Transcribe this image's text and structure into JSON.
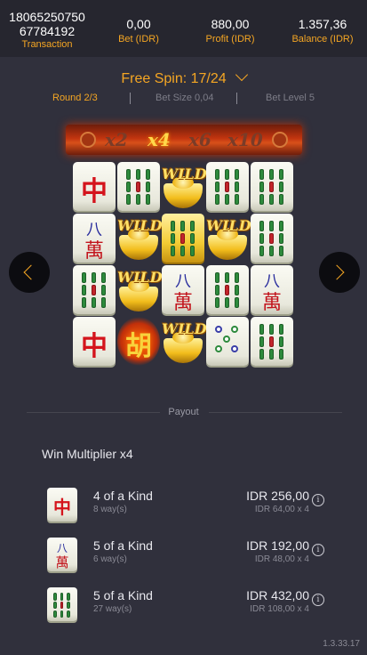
{
  "header": {
    "transaction_id_line1": "18065250750",
    "transaction_id_line2": "67784192",
    "transaction_label": "Transaction",
    "bet_value": "0,00",
    "bet_label": "Bet (IDR)",
    "profit_value": "880,00",
    "profit_label": "Profit (IDR)",
    "balance_value": "1.357,36",
    "balance_label": "Balance (IDR)"
  },
  "spin": {
    "title": "Free Spin: 17/24",
    "round": "Round 2/3",
    "bet_size": "Bet Size 0,04",
    "bet_level": "Bet Level 5"
  },
  "multipliers": {
    "items": [
      "x2",
      "x4",
      "x6",
      "x10"
    ],
    "active_index": 1
  },
  "grid": {
    "wild_label": "WILD",
    "columns": [
      [
        "zhong",
        "wan",
        "bamboo",
        "zhong"
      ],
      [
        "bamboo",
        "wild",
        "wild",
        "hu"
      ],
      [
        "wild",
        "bamboo-gold",
        "wan",
        "wild"
      ],
      [
        "bamboo",
        "wild",
        "bamboo",
        "dots"
      ],
      [
        "bamboo",
        "bamboo",
        "wan",
        "bamboo"
      ]
    ]
  },
  "payout": {
    "section_label": "Payout",
    "win_multiplier": "Win Multiplier x4",
    "rows": [
      {
        "symbol": "zhong",
        "name": "4 of a Kind",
        "ways": "8 way(s)",
        "amount": "IDR 256,00",
        "calc": "IDR 64,00 x 4"
      },
      {
        "symbol": "wan",
        "name": "5 of a Kind",
        "ways": "6 way(s)",
        "amount": "IDR 192,00",
        "calc": "IDR 48,00 x 4"
      },
      {
        "symbol": "bamboo",
        "name": "5 of a Kind",
        "ways": "27 way(s)",
        "amount": "IDR 432,00",
        "calc": "IDR 108,00 x 4"
      }
    ],
    "info_glyph": "i"
  },
  "version": "1.3.33.17",
  "colors": {
    "accent": "#f5a623",
    "background": "#30303c",
    "header_bg": "#26262f"
  }
}
